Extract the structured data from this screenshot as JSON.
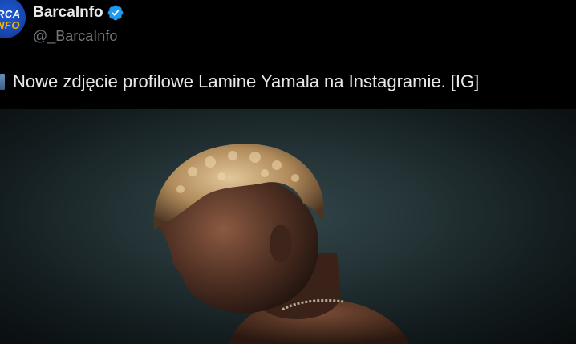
{
  "account": {
    "display_name": "BarcaInfo",
    "handle": "@_BarcaInfo",
    "verified": true,
    "avatar_text_line1": "RCA",
    "avatar_text_line2": "NFO",
    "avatar_color": "#1a4fc4"
  },
  "tweet": {
    "text": "Nowe zdjęcie profilowe Lamine Yamala na Instagramie. [IG]"
  },
  "icons": {
    "verified": "verified-badge-icon",
    "text_prefix": "photo-emoji-icon"
  },
  "colors": {
    "background": "#000000",
    "primary_text": "#e7e9ea",
    "secondary_text": "#71767b",
    "verified_blue": "#1d9bf0"
  }
}
